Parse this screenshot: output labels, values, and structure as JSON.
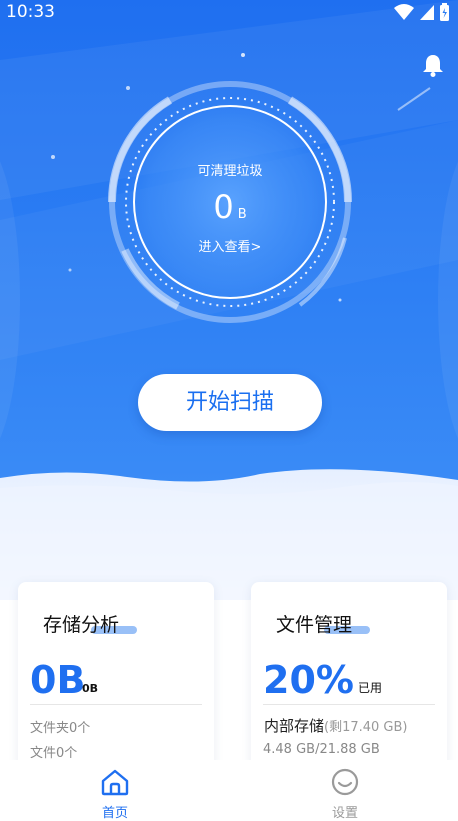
{
  "status": {
    "time": "10:33"
  },
  "ring": {
    "label": "可清理垃圾",
    "value": "0",
    "unit": "B",
    "enter": "进入查看>"
  },
  "scan_button": "开始扫描",
  "storage_card": {
    "title": "存储分析",
    "value": "0B",
    "value_sub": "0B",
    "folders": "文件夹0个",
    "files": "文件0个"
  },
  "files_card": {
    "title": "文件管理",
    "percent": "20%",
    "percent_label": "已用",
    "internal_label": "内部存储",
    "remaining": "(剩17.40 GB)",
    "usage": "4.48 GB/21.88 GB"
  },
  "tabs": [
    {
      "label": "首页",
      "active": true,
      "icon": "home-icon"
    },
    {
      "label": "设置",
      "active": false,
      "icon": "smiley-icon"
    }
  ],
  "colors": {
    "primary": "#1f6ff0",
    "inactive": "#9a9a9a"
  }
}
